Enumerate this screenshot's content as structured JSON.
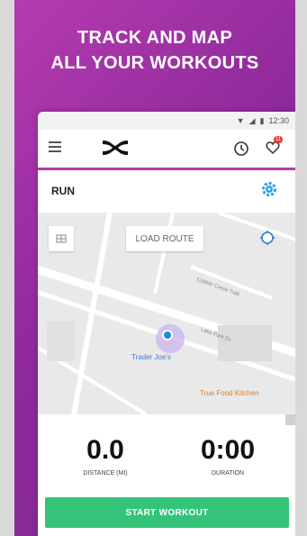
{
  "promo": {
    "headline_line1": "TRACK AND MAP",
    "headline_line2": "ALL YOUR WORKOUTS",
    "background_colors": [
      "#b43bb0",
      "#7b2a8e"
    ]
  },
  "status_bar": {
    "time": "12:30"
  },
  "app_bar": {
    "notification_count": "11",
    "accent_color": "#b43bb0",
    "icons": [
      "menu-icon",
      "under-armour-logo",
      "clock-icon",
      "heart-icon"
    ]
  },
  "activity": {
    "label": "RUN"
  },
  "map": {
    "load_route_label": "LOAD ROUTE",
    "streets": [
      "Cobble Creek Trail",
      "Lake Park Dr"
    ],
    "places": [
      "Trader Joe's",
      "True Food Kitchen"
    ]
  },
  "stats": {
    "distance_value": "0.0",
    "distance_label": "DISTANCE (MI)",
    "duration_value": "0:00",
    "duration_label": "DURATION"
  },
  "actions": {
    "start_label": "START WORKOUT",
    "start_color": "#33c47a"
  }
}
